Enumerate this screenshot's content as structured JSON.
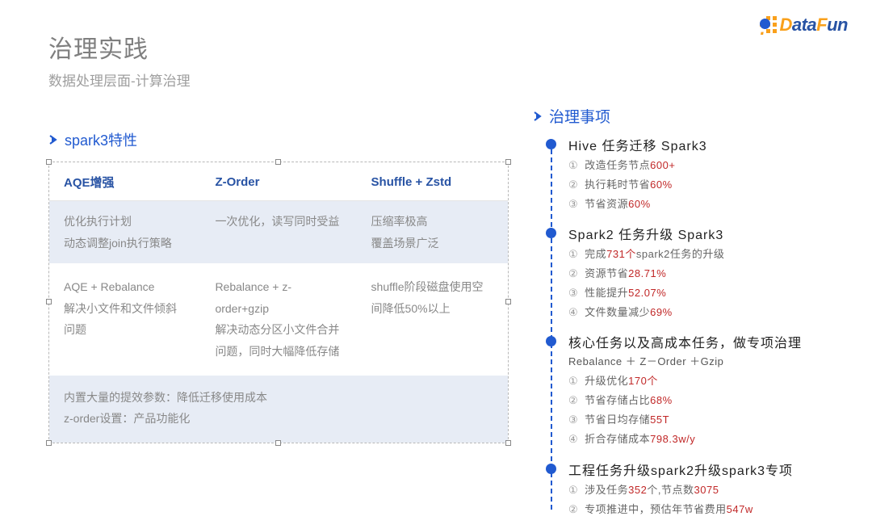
{
  "logo": {
    "text_d": "D",
    "text_ata": "ata",
    "text_f": "F",
    "text_un": "un",
    "dot": "."
  },
  "header": {
    "title": "治理实践",
    "subtitle": "数据处理层面-计算治理"
  },
  "left": {
    "section_title": "spark3特性",
    "columns": [
      "AQE增强",
      "Z-Order",
      "Shuffle + Zstd"
    ],
    "row1": [
      "优化执行计划\n动态调整join执行策略",
      "一次优化，读写同时受益",
      "压缩率极高\n覆盖场景广泛"
    ],
    "row2": [
      "AQE + Rebalance\n解决小文件和文件倾斜问题",
      "Rebalance + z-order+gzip\n解决动态分区小文件合并问题，同时大幅降低存储",
      "shuffle阶段磁盘使用空间降低50%以上"
    ],
    "row3": "内置大量的提效参数：降低迁移使用成本\nz-order设置：产品功能化"
  },
  "right": {
    "section_title": "治理事项",
    "items": [
      {
        "title": "Hive 任务迁移 Spark3",
        "sub": "",
        "lines": [
          [
            {
              "t": "①",
              "c": "num"
            },
            {
              "t": "改造任务节点"
            },
            {
              "t": "600+",
              "c": "red"
            }
          ],
          [
            {
              "t": "②",
              "c": "num"
            },
            {
              "t": "执行耗时节省"
            },
            {
              "t": "60%",
              "c": "red"
            }
          ],
          [
            {
              "t": "③",
              "c": "num"
            },
            {
              "t": "节省资源"
            },
            {
              "t": "60%",
              "c": "red"
            }
          ]
        ]
      },
      {
        "title": "Spark2 任务升级 Spark3",
        "sub": "",
        "lines": [
          [
            {
              "t": "①",
              "c": "num"
            },
            {
              "t": "完成"
            },
            {
              "t": "731个",
              "c": "red"
            },
            {
              "t": "spark2任务的升级"
            }
          ],
          [
            {
              "t": "②",
              "c": "num"
            },
            {
              "t": "资源节省"
            },
            {
              "t": "28.71%",
              "c": "red"
            }
          ],
          [
            {
              "t": "③",
              "c": "num"
            },
            {
              "t": "性能提升"
            },
            {
              "t": "52.07%",
              "c": "red"
            }
          ],
          [
            {
              "t": "④",
              "c": "num"
            },
            {
              "t": "文件数量减少"
            },
            {
              "t": "69%",
              "c": "red"
            }
          ]
        ]
      },
      {
        "title": "核心任务以及高成本任务，做专项治理",
        "sub": "Rebalance ＋ Z－Order ＋Gzip",
        "lines": [
          [
            {
              "t": "①",
              "c": "num"
            },
            {
              "t": "升级优化"
            },
            {
              "t": "170个",
              "c": "red"
            }
          ],
          [
            {
              "t": "②",
              "c": "num"
            },
            {
              "t": "节省存储占比"
            },
            {
              "t": "68%",
              "c": "red"
            }
          ],
          [
            {
              "t": "③",
              "c": "num"
            },
            {
              "t": "节省日均存储"
            },
            {
              "t": "55T",
              "c": "red"
            }
          ],
          [
            {
              "t": "④",
              "c": "num"
            },
            {
              "t": "折合存储成本"
            },
            {
              "t": "798.3w/y",
              "c": "red"
            }
          ]
        ]
      },
      {
        "title": "工程任务升级spark2升级spark3专项",
        "sub": "",
        "lines": [
          [
            {
              "t": "①",
              "c": "num"
            },
            {
              "t": "涉及任务"
            },
            {
              "t": "352",
              "c": "red"
            },
            {
              "t": "个,节点数"
            },
            {
              "t": "3075",
              "c": "red"
            }
          ],
          [
            {
              "t": "②",
              "c": "num"
            },
            {
              "t": "专项推进中，预估年节省费用"
            },
            {
              "t": "547w",
              "c": "red"
            }
          ]
        ]
      }
    ]
  }
}
